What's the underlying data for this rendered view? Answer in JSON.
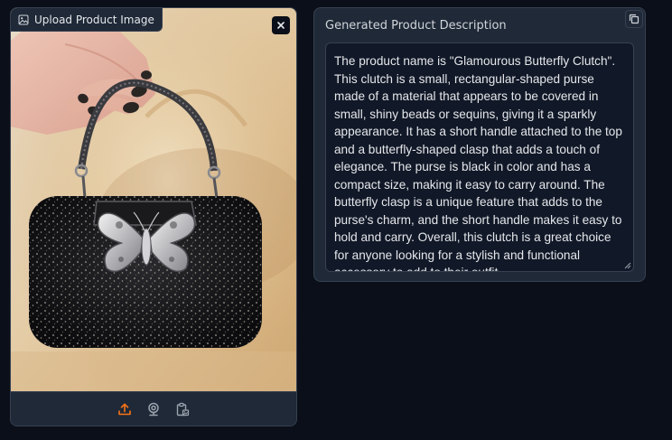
{
  "upload": {
    "label": "Upload Product Image",
    "label_icon": "image-icon",
    "close_icon": "close-icon",
    "toolbar": [
      {
        "name": "upload-icon",
        "color": "#f97316"
      },
      {
        "name": "webcam-icon",
        "color": "#9ca3af"
      },
      {
        "name": "clipboard-icon",
        "color": "#9ca3af"
      }
    ]
  },
  "description": {
    "title": "Generated Product Description",
    "copy_icon": "copy-icon",
    "text": "The product name is \"Glamourous Butterfly Clutch\". This clutch is a small, rectangular-shaped purse made of a material that appears to be covered in small, shiny beads or sequins, giving it a sparkly appearance. It has a short handle attached to the top and a butterfly-shaped clasp that adds a touch of elegance. The purse is black in color and has a compact size, making it easy to carry around. The butterfly clasp is a unique feature that adds to the purse's charm, and the short handle makes it easy to hold and carry. Overall, this clutch is a great choice for anyone looking for a stylish and functional accessory to add to their outfit."
  },
  "colors": {
    "background": "#0b0f19",
    "panel": "#1f2937",
    "border": "#374151",
    "accent": "#f97316"
  }
}
